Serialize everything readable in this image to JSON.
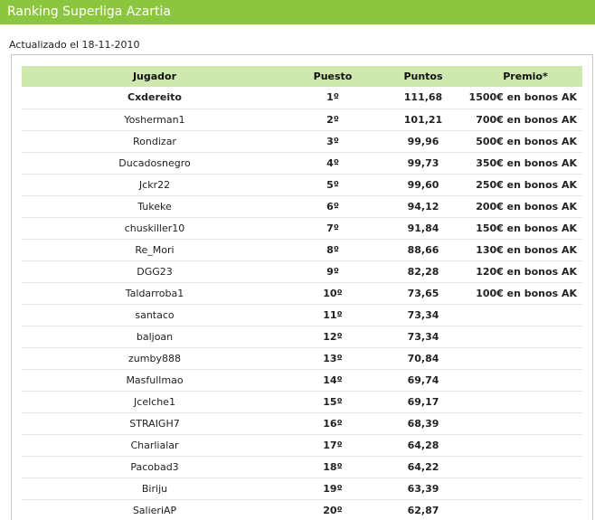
{
  "header": {
    "title": "Ranking Superliga Azartia"
  },
  "updated_text": "Actualizado el 18-11-2010",
  "table": {
    "columns": [
      "Jugador",
      "Puesto",
      "Puntos",
      "Premio*"
    ],
    "rows": [
      {
        "player": "Cxdereito",
        "position": "1º",
        "points": "111,68",
        "prize": "1500€ en bonos AK"
      },
      {
        "player": "Yosherman1",
        "position": "2º",
        "points": "101,21",
        "prize": "700€ en bonos AK"
      },
      {
        "player": "Rondizar",
        "position": "3º",
        "points": "99,96",
        "prize": "500€ en bonos AK"
      },
      {
        "player": "Ducadosnegro",
        "position": "4º",
        "points": "99,73",
        "prize": "350€ en bonos AK"
      },
      {
        "player": "Jckr22",
        "position": "5º",
        "points": "99,60",
        "prize": "250€ en bonos AK"
      },
      {
        "player": "Tukeke",
        "position": "6º",
        "points": "94,12",
        "prize": "200€ en bonos AK"
      },
      {
        "player": "chuskiller10",
        "position": "7º",
        "points": "91,84",
        "prize": "150€ en bonos AK"
      },
      {
        "player": "Re_Mori",
        "position": "8º",
        "points": "88,66",
        "prize": "130€ en bonos AK"
      },
      {
        "player": "DGG23",
        "position": "9º",
        "points": "82,28",
        "prize": "120€ en bonos AK"
      },
      {
        "player": "Taldarroba1",
        "position": "10º",
        "points": "73,65",
        "prize": "100€ en bonos AK"
      },
      {
        "player": "santaco",
        "position": "11º",
        "points": "73,34",
        "prize": ""
      },
      {
        "player": "baljoan",
        "position": "12º",
        "points": "73,34",
        "prize": ""
      },
      {
        "player": "zumby888",
        "position": "13º",
        "points": "70,84",
        "prize": ""
      },
      {
        "player": "Masfullmao",
        "position": "14º",
        "points": "69,74",
        "prize": ""
      },
      {
        "player": "Jcelche1",
        "position": "15º",
        "points": "69,17",
        "prize": ""
      },
      {
        "player": "STRAIGH7",
        "position": "16º",
        "points": "68,39",
        "prize": ""
      },
      {
        "player": "Charlialar",
        "position": "17º",
        "points": "64,28",
        "prize": ""
      },
      {
        "player": "Pacobad3",
        "position": "18º",
        "points": "64,22",
        "prize": ""
      },
      {
        "player": "Biriju",
        "position": "19º",
        "points": "63,39",
        "prize": ""
      },
      {
        "player": "SalieriAP",
        "position": "20º",
        "points": "62,87",
        "prize": ""
      }
    ]
  },
  "colors": {
    "title_bar": "#8cc63f",
    "header_row": "#cfe8ad"
  }
}
